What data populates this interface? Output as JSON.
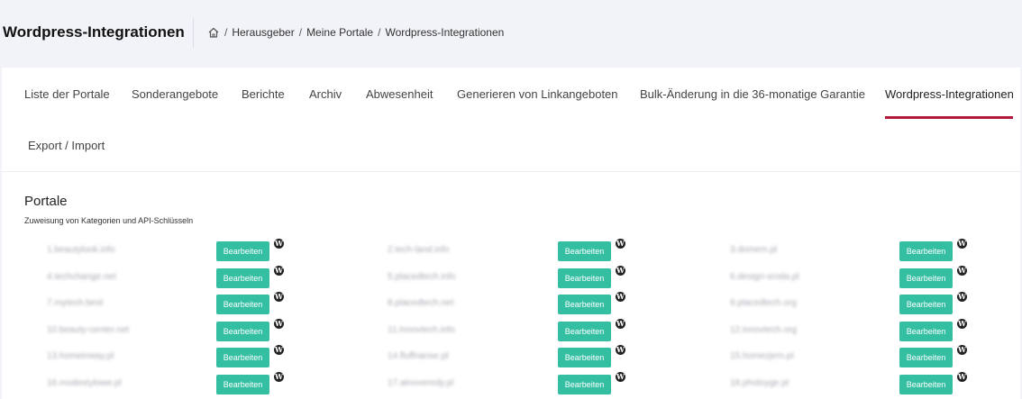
{
  "header": {
    "title": "Wordpress-Integrationen",
    "breadcrumb": [
      "Herausgeber",
      "Meine Portale",
      "Wordpress-Integrationen"
    ],
    "separator": "/"
  },
  "tabs": [
    {
      "label": "Liste der Portale"
    },
    {
      "label": "Sonderangebote"
    },
    {
      "label": "Berichte"
    },
    {
      "label": "Archiv"
    },
    {
      "label": "Abwesenheit"
    },
    {
      "label": "Generieren von Linkangeboten"
    },
    {
      "label": "Bulk-Änderung in die 36-monatige Garantie"
    },
    {
      "label": "Wordpress-Integrationen",
      "active": true
    },
    {
      "label": "Export / Import"
    }
  ],
  "section": {
    "title": "Portale",
    "subtitle": "Zuweisung von Kategorien und API-Schlüsseln"
  },
  "portals": [
    {
      "name": "1.beautylook.info",
      "button": "Bearbeiten"
    },
    {
      "name": "2.tech-land.info",
      "button": "Bearbeiten"
    },
    {
      "name": "3.domem.pl",
      "button": "Bearbeiten"
    },
    {
      "name": "4.techchange.net",
      "button": "Bearbeiten"
    },
    {
      "name": "5.placedtech.info",
      "button": "Bearbeiten"
    },
    {
      "name": "6.design-sroda.pl",
      "button": "Bearbeiten"
    },
    {
      "name": "7.mytech.best",
      "button": "Bearbeiten"
    },
    {
      "name": "8.placedtech.net",
      "button": "Bearbeiten"
    },
    {
      "name": "9.placedtech.org",
      "button": "Bearbeiten"
    },
    {
      "name": "10.beauty-center.net",
      "button": "Bearbeiten"
    },
    {
      "name": "11.innovtech.info",
      "button": "Bearbeiten"
    },
    {
      "name": "12.innovtech.org",
      "button": "Bearbeiten"
    },
    {
      "name": "13.homeinway.pl",
      "button": "Bearbeiten"
    },
    {
      "name": "14.fluffnanse.pl",
      "button": "Bearbeiten"
    },
    {
      "name": "15.homezjem.pl",
      "button": "Bearbeiten"
    },
    {
      "name": "16.modestylowe.pl",
      "button": "Bearbeiten"
    },
    {
      "name": "17.atnoveredy.pl",
      "button": "Bearbeiten"
    },
    {
      "name": "18.pholoyge.pl",
      "button": "Bearbeiten"
    }
  ],
  "icons": {
    "home": "home-icon",
    "wordpress": "wordpress-icon"
  },
  "colors": {
    "accent_button": "#34bfa3",
    "active_tab_underline": "#b3193a"
  }
}
